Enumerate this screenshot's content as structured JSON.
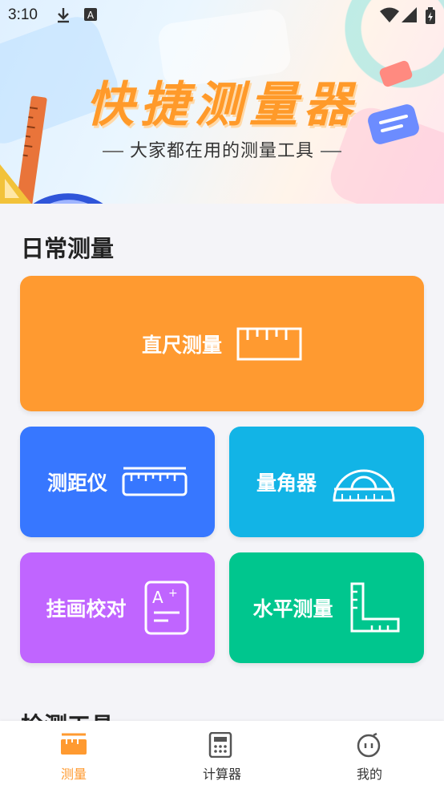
{
  "status_bar": {
    "time": "3:10"
  },
  "banner": {
    "title": "快捷测量器",
    "subtitle": "大家都在用的测量工具"
  },
  "sections": {
    "daily_title": "日常测量",
    "tools_title": "检测工具"
  },
  "cards": {
    "ruler": "直尺测量",
    "distance": "测距仪",
    "angle": "量角器",
    "picture": "挂画校对",
    "level": "水平测量"
  },
  "bottom_nav": {
    "items": [
      {
        "label": "测量",
        "icon": "ruler-tab-icon",
        "active": true
      },
      {
        "label": "计算器",
        "icon": "calculator-icon",
        "active": false
      },
      {
        "label": "我的",
        "icon": "profile-face-icon",
        "active": false
      }
    ],
    "active_color": "#ff9a30",
    "inactive_color": "#333333"
  },
  "colors": {
    "ruler_card": "#ff9a30",
    "distance_card": "#3777ff",
    "angle_card": "#12b4e6",
    "picture_card": "#c065ff",
    "level_card": "#00c68e"
  }
}
